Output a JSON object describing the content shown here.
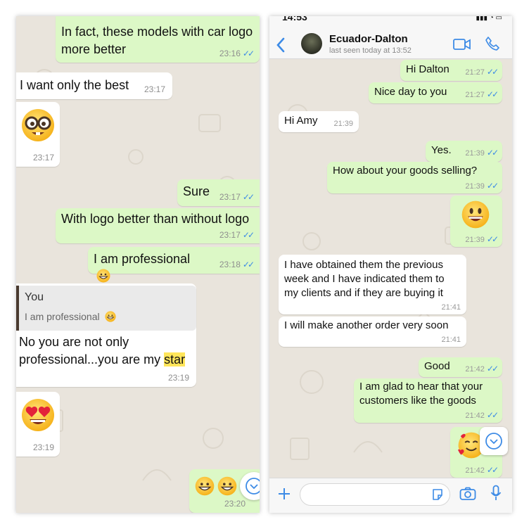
{
  "left": {
    "messages": [
      {
        "text": "In fact, these models with car logo\nmore better",
        "time": "23:16"
      },
      {
        "text": "I want only the best",
        "time": "23:17"
      },
      {
        "emoji": "nerd-face",
        "time": "23:17"
      },
      {
        "text": "Sure",
        "time": "23:17"
      },
      {
        "text": "With logo better than without logo",
        "time": "23:17"
      },
      {
        "text": "I am professional",
        "time": "23:18"
      },
      {
        "reply_author": "You",
        "reply_text": "I am professional",
        "text_main": "No you are not only\nprofessional...you are my ",
        "highlight": "star",
        "time": "23:19"
      },
      {
        "emoji": "heart-eyes",
        "time": "23:19"
      },
      {
        "time": "23:20"
      }
    ]
  },
  "right": {
    "status_time": "14:53",
    "contact_name": "Ecuador-Dalton",
    "last_seen": "last seen today at 13:52",
    "messages": [
      {
        "text": "Hi Dalton",
        "time": "21:27"
      },
      {
        "text": "Nice day to you",
        "time": "21:27"
      },
      {
        "text": "Hi Amy",
        "time": "21:39"
      },
      {
        "text": "Yes.",
        "time": "21:39"
      },
      {
        "text": "How about your goods selling?",
        "time": "21:39"
      },
      {
        "emoji": "smile",
        "time": "21:39"
      },
      {
        "text": "I have obtained them the previous\nweek and I have indicated them to\nmy clients and if they are buying it",
        "time": "21:41"
      },
      {
        "text": "I will make another order very soon",
        "time": "21:41"
      },
      {
        "text": "Good",
        "time": "21:42"
      },
      {
        "text": "I am glad to hear that your\ncustomers like the goods",
        "time": "21:42"
      },
      {
        "emoji": "smiling-hearts",
        "time": "21:42"
      }
    ]
  },
  "colors": {
    "outgoing": "#dcf8c6",
    "incoming": "#ffffff",
    "wallpaper": "#e9e4dc",
    "ios_blue": "#3d8be6",
    "highlight": "#ffe55a"
  }
}
